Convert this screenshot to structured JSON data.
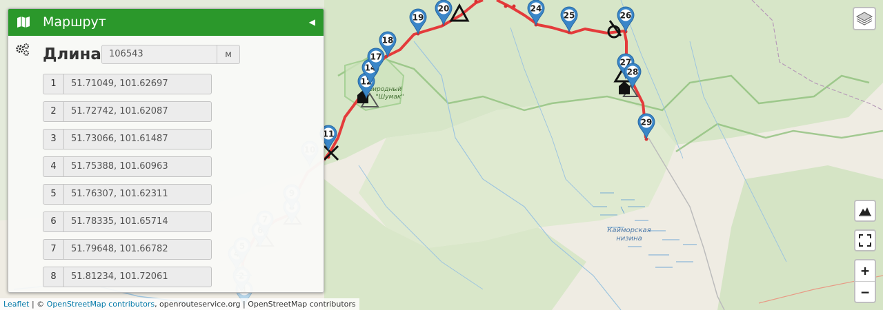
{
  "panel": {
    "title": "Маршрут",
    "length_label": "Длина",
    "length_value": "106543",
    "length_unit": "м",
    "waypoints": [
      {
        "index": "1",
        "coords": "51.71049, 101.62697"
      },
      {
        "index": "2",
        "coords": "51.72742, 101.62087"
      },
      {
        "index": "3",
        "coords": "51.73066, 101.61487"
      },
      {
        "index": "4",
        "coords": "51.75388, 101.60963"
      },
      {
        "index": "5",
        "coords": "51.76307, 101.62311"
      },
      {
        "index": "6",
        "coords": "51.78335, 101.65714"
      },
      {
        "index": "7",
        "coords": "51.79648, 101.66782"
      },
      {
        "index": "8",
        "coords": "51.81234, 101.72061"
      }
    ]
  },
  "map": {
    "labels": {
      "park_line1": "Природный",
      "park_line2": "\"Шумак\"",
      "lowland_line1": "Кайморская",
      "lowland_line2": "низина"
    },
    "markers_active": [
      "11",
      "12",
      "14",
      "17",
      "18",
      "19",
      "20",
      "24",
      "25",
      "26",
      "27",
      "28",
      "29"
    ],
    "markers_faded": [
      "1",
      "2",
      "4",
      "5",
      "6",
      "7",
      "8",
      "9",
      "10"
    ],
    "colors": {
      "route": "#e43b3b",
      "marker": "#3a86c8",
      "marker_faded": "#b7d6ea",
      "header": "#2b982b"
    }
  },
  "controls": {
    "zoom_in": "+",
    "zoom_out": "−"
  },
  "attribution": {
    "leaflet": "Leaflet",
    "sep1": " | © ",
    "osm": "OpenStreetMap contributors",
    "rest": ", openrouteservice.org | OpenStreetMap contributors"
  }
}
